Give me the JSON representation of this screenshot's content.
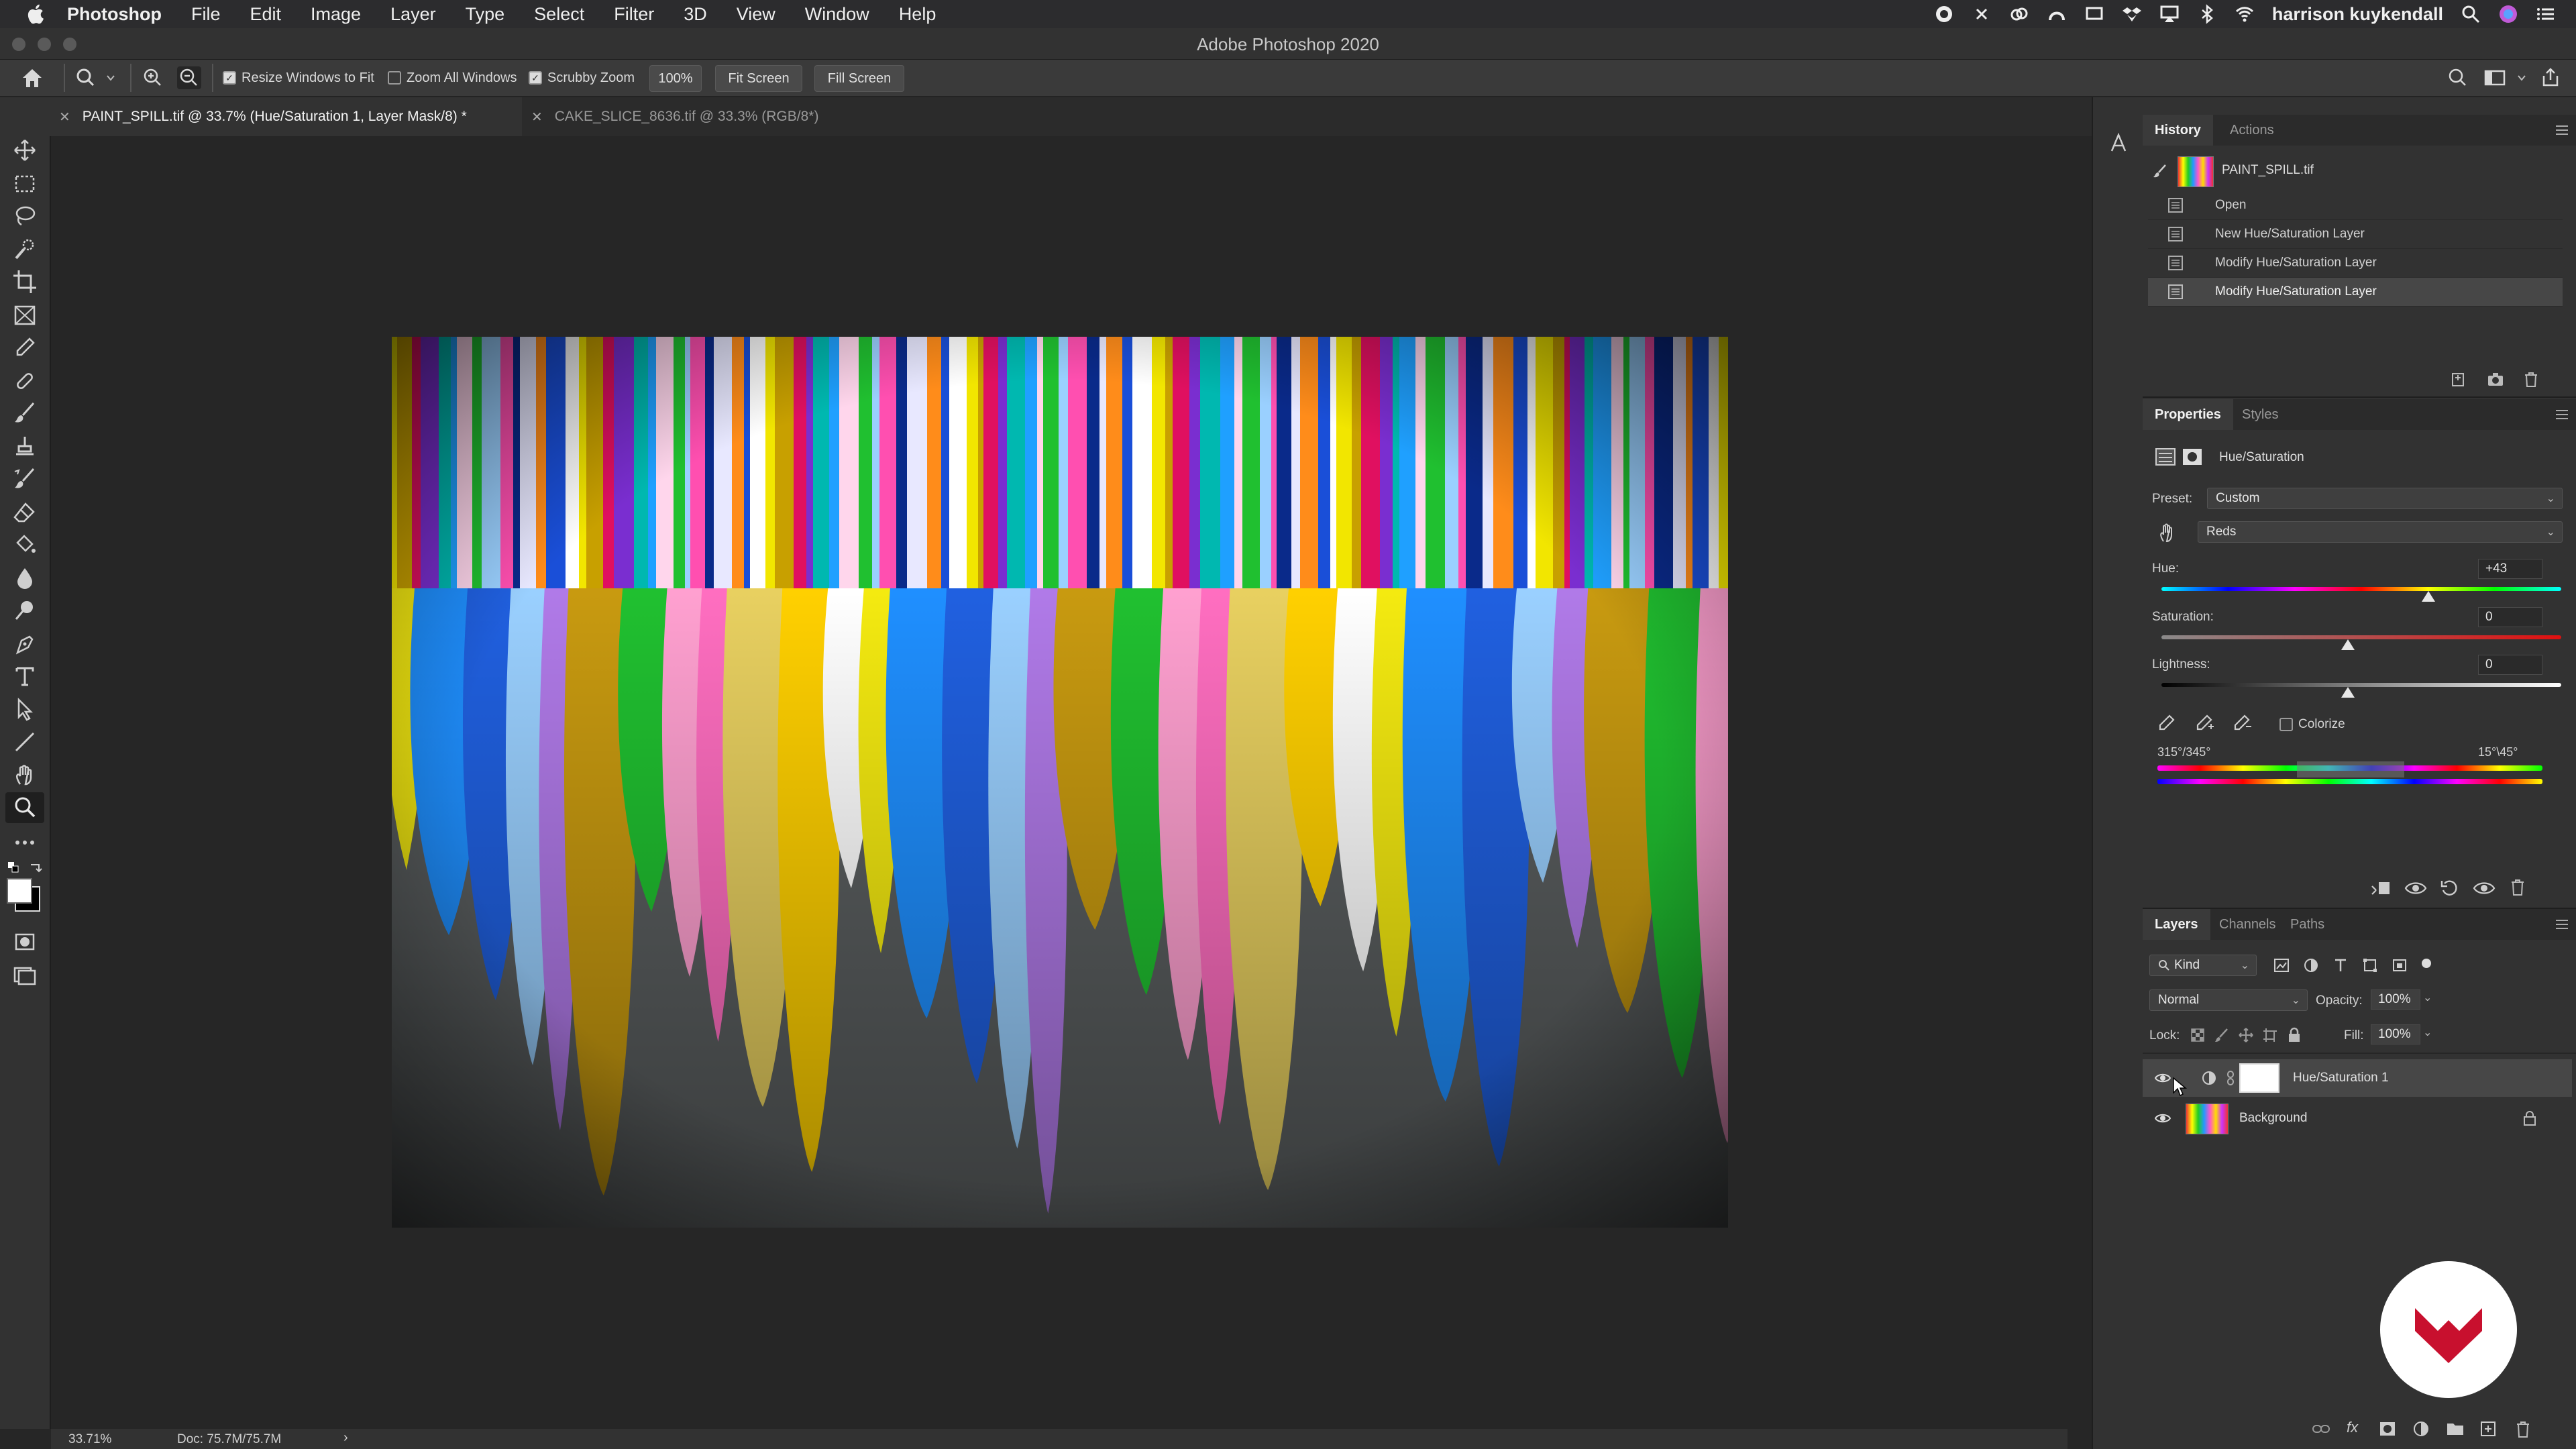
{
  "menubar": {
    "app": "Photoshop",
    "items": [
      "File",
      "Edit",
      "Image",
      "Layer",
      "Type",
      "Select",
      "Filter",
      "3D",
      "View",
      "Window",
      "Help"
    ],
    "user": "harrison kuykendall"
  },
  "window": {
    "title": "Adobe Photoshop 2020"
  },
  "options": {
    "resize_windows": "Resize Windows to Fit",
    "zoom_all": "Zoom All Windows",
    "scrubby": "Scrubby Zoom",
    "zoom_value": "100%",
    "fit_screen": "Fit Screen",
    "fill_screen": "Fill Screen"
  },
  "tabs": [
    {
      "label": "PAINT_SPILL.tif @ 33.7% (Hue/Saturation 1, Layer Mask/8) *",
      "active": true
    },
    {
      "label": "CAKE_SLICE_8636.tif @ 33.3% (RGB/8*)",
      "active": false
    }
  ],
  "status": {
    "zoom": "33.71%",
    "doc": "Doc: 75.7M/75.7M"
  },
  "history": {
    "tabs": [
      "History",
      "Actions"
    ],
    "snapshot": "PAINT_SPILL.tif",
    "items": [
      "Open",
      "New Hue/Saturation Layer",
      "Modify Hue/Saturation Layer",
      "Modify Hue/Saturation Layer"
    ]
  },
  "properties": {
    "tabs": [
      "Properties",
      "Styles"
    ],
    "type": "Hue/Saturation",
    "preset_label": "Preset:",
    "preset_value": "Custom",
    "channel_value": "Reds",
    "hue_label": "Hue:",
    "hue_value": "+43",
    "sat_label": "Saturation:",
    "sat_value": "0",
    "light_label": "Lightness:",
    "light_value": "0",
    "colorize": "Colorize",
    "range_left": "315°/345°",
    "range_right": "15°\\45°"
  },
  "layers": {
    "tabs": [
      "Layers",
      "Channels",
      "Paths"
    ],
    "kind": "Kind",
    "blend": "Normal",
    "opacity_label": "Opacity:",
    "opacity_value": "100%",
    "lock_label": "Lock:",
    "fill_label": "Fill:",
    "fill_value": "100%",
    "items": [
      {
        "name": "Hue/Saturation 1",
        "selected": true
      },
      {
        "name": "Background",
        "selected": false
      }
    ]
  }
}
